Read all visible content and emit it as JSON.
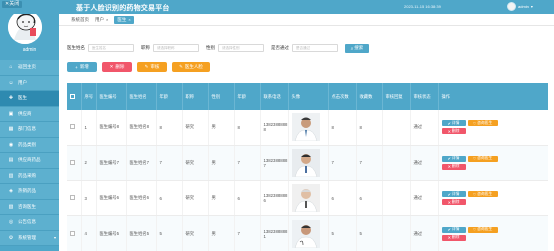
{
  "header": {
    "close_label": "关闭",
    "title": "基于人脸识别的药物交易平台",
    "datetime": "2023-11-15 16:38:39",
    "user": "admin"
  },
  "sidebar": {
    "user": "admin",
    "items": [
      {
        "icon": "home-icon",
        "glyph": "⌂",
        "label": "返回主页"
      },
      {
        "icon": "user-icon",
        "glyph": "☺",
        "label": "用户"
      },
      {
        "icon": "doctor-icon",
        "glyph": "✚",
        "label": "医生"
      },
      {
        "icon": "truck-icon",
        "glyph": "▣",
        "label": "供应商"
      },
      {
        "icon": "department-icon",
        "glyph": "▦",
        "label": "部门信息"
      },
      {
        "icon": "pill-icon",
        "glyph": "◉",
        "label": "药品类别"
      },
      {
        "icon": "supply-icon",
        "glyph": "▤",
        "label": "供应商药品"
      },
      {
        "icon": "purchase-icon",
        "glyph": "▥",
        "label": "药品采购"
      },
      {
        "icon": "sale-icon",
        "glyph": "◈",
        "label": "热销药品"
      },
      {
        "icon": "consult-icon",
        "glyph": "▧",
        "label": "咨询医生"
      },
      {
        "icon": "notice-icon",
        "glyph": "◎",
        "label": "公告信息"
      },
      {
        "icon": "settings-icon",
        "glyph": "⚙",
        "label": "系统管理"
      }
    ]
  },
  "tabs": [
    {
      "label": "系统首页",
      "close": ""
    },
    {
      "label": "用户",
      "close": "×"
    },
    {
      "label": "医生",
      "close": "×"
    }
  ],
  "search": {
    "fields": [
      {
        "label": "医生姓名",
        "placeholder": "医生姓名"
      },
      {
        "label": "职称",
        "placeholder": "请选择职称"
      },
      {
        "label": "性别",
        "placeholder": "请选择性别"
      },
      {
        "label": "是否通过",
        "placeholder": "是否通过"
      }
    ],
    "button": "搜索"
  },
  "actions": {
    "add": "新增",
    "delete": "删除",
    "audit": "审核",
    "audit_all": "医生人脸"
  },
  "table": {
    "headers": [
      "",
      "序号",
      "医生编号",
      "医生姓名",
      "年龄",
      "职称",
      "性别",
      "年龄",
      "联系电话",
      "头像",
      "点击次数",
      "收藏数",
      "审核回复",
      "审核状态",
      "操作"
    ],
    "rows": [
      [
        "1",
        "医生编号8",
        "医生姓名8",
        "8",
        "研究",
        "男",
        "8",
        "13823888888",
        "",
        "8",
        "8",
        "",
        "通过"
      ],
      [
        "2",
        "医生编号7",
        "医生姓名7",
        "7",
        "研究",
        "男",
        "7",
        "13823888887",
        "",
        "7",
        "7",
        "",
        "通过"
      ],
      [
        "3",
        "医生编号6",
        "医生姓名6",
        "6",
        "研究",
        "男",
        "6",
        "13823888886",
        "",
        "6",
        "6",
        "",
        "通过"
      ],
      [
        "4",
        "医生编号5",
        "医生姓名5",
        "5",
        "研究",
        "男",
        "7",
        "13823888881",
        "",
        "5",
        "5",
        "",
        "通过"
      ]
    ],
    "op_view": "详情",
    "op_stat": "咨询医生",
    "op_delete": "删除"
  }
}
